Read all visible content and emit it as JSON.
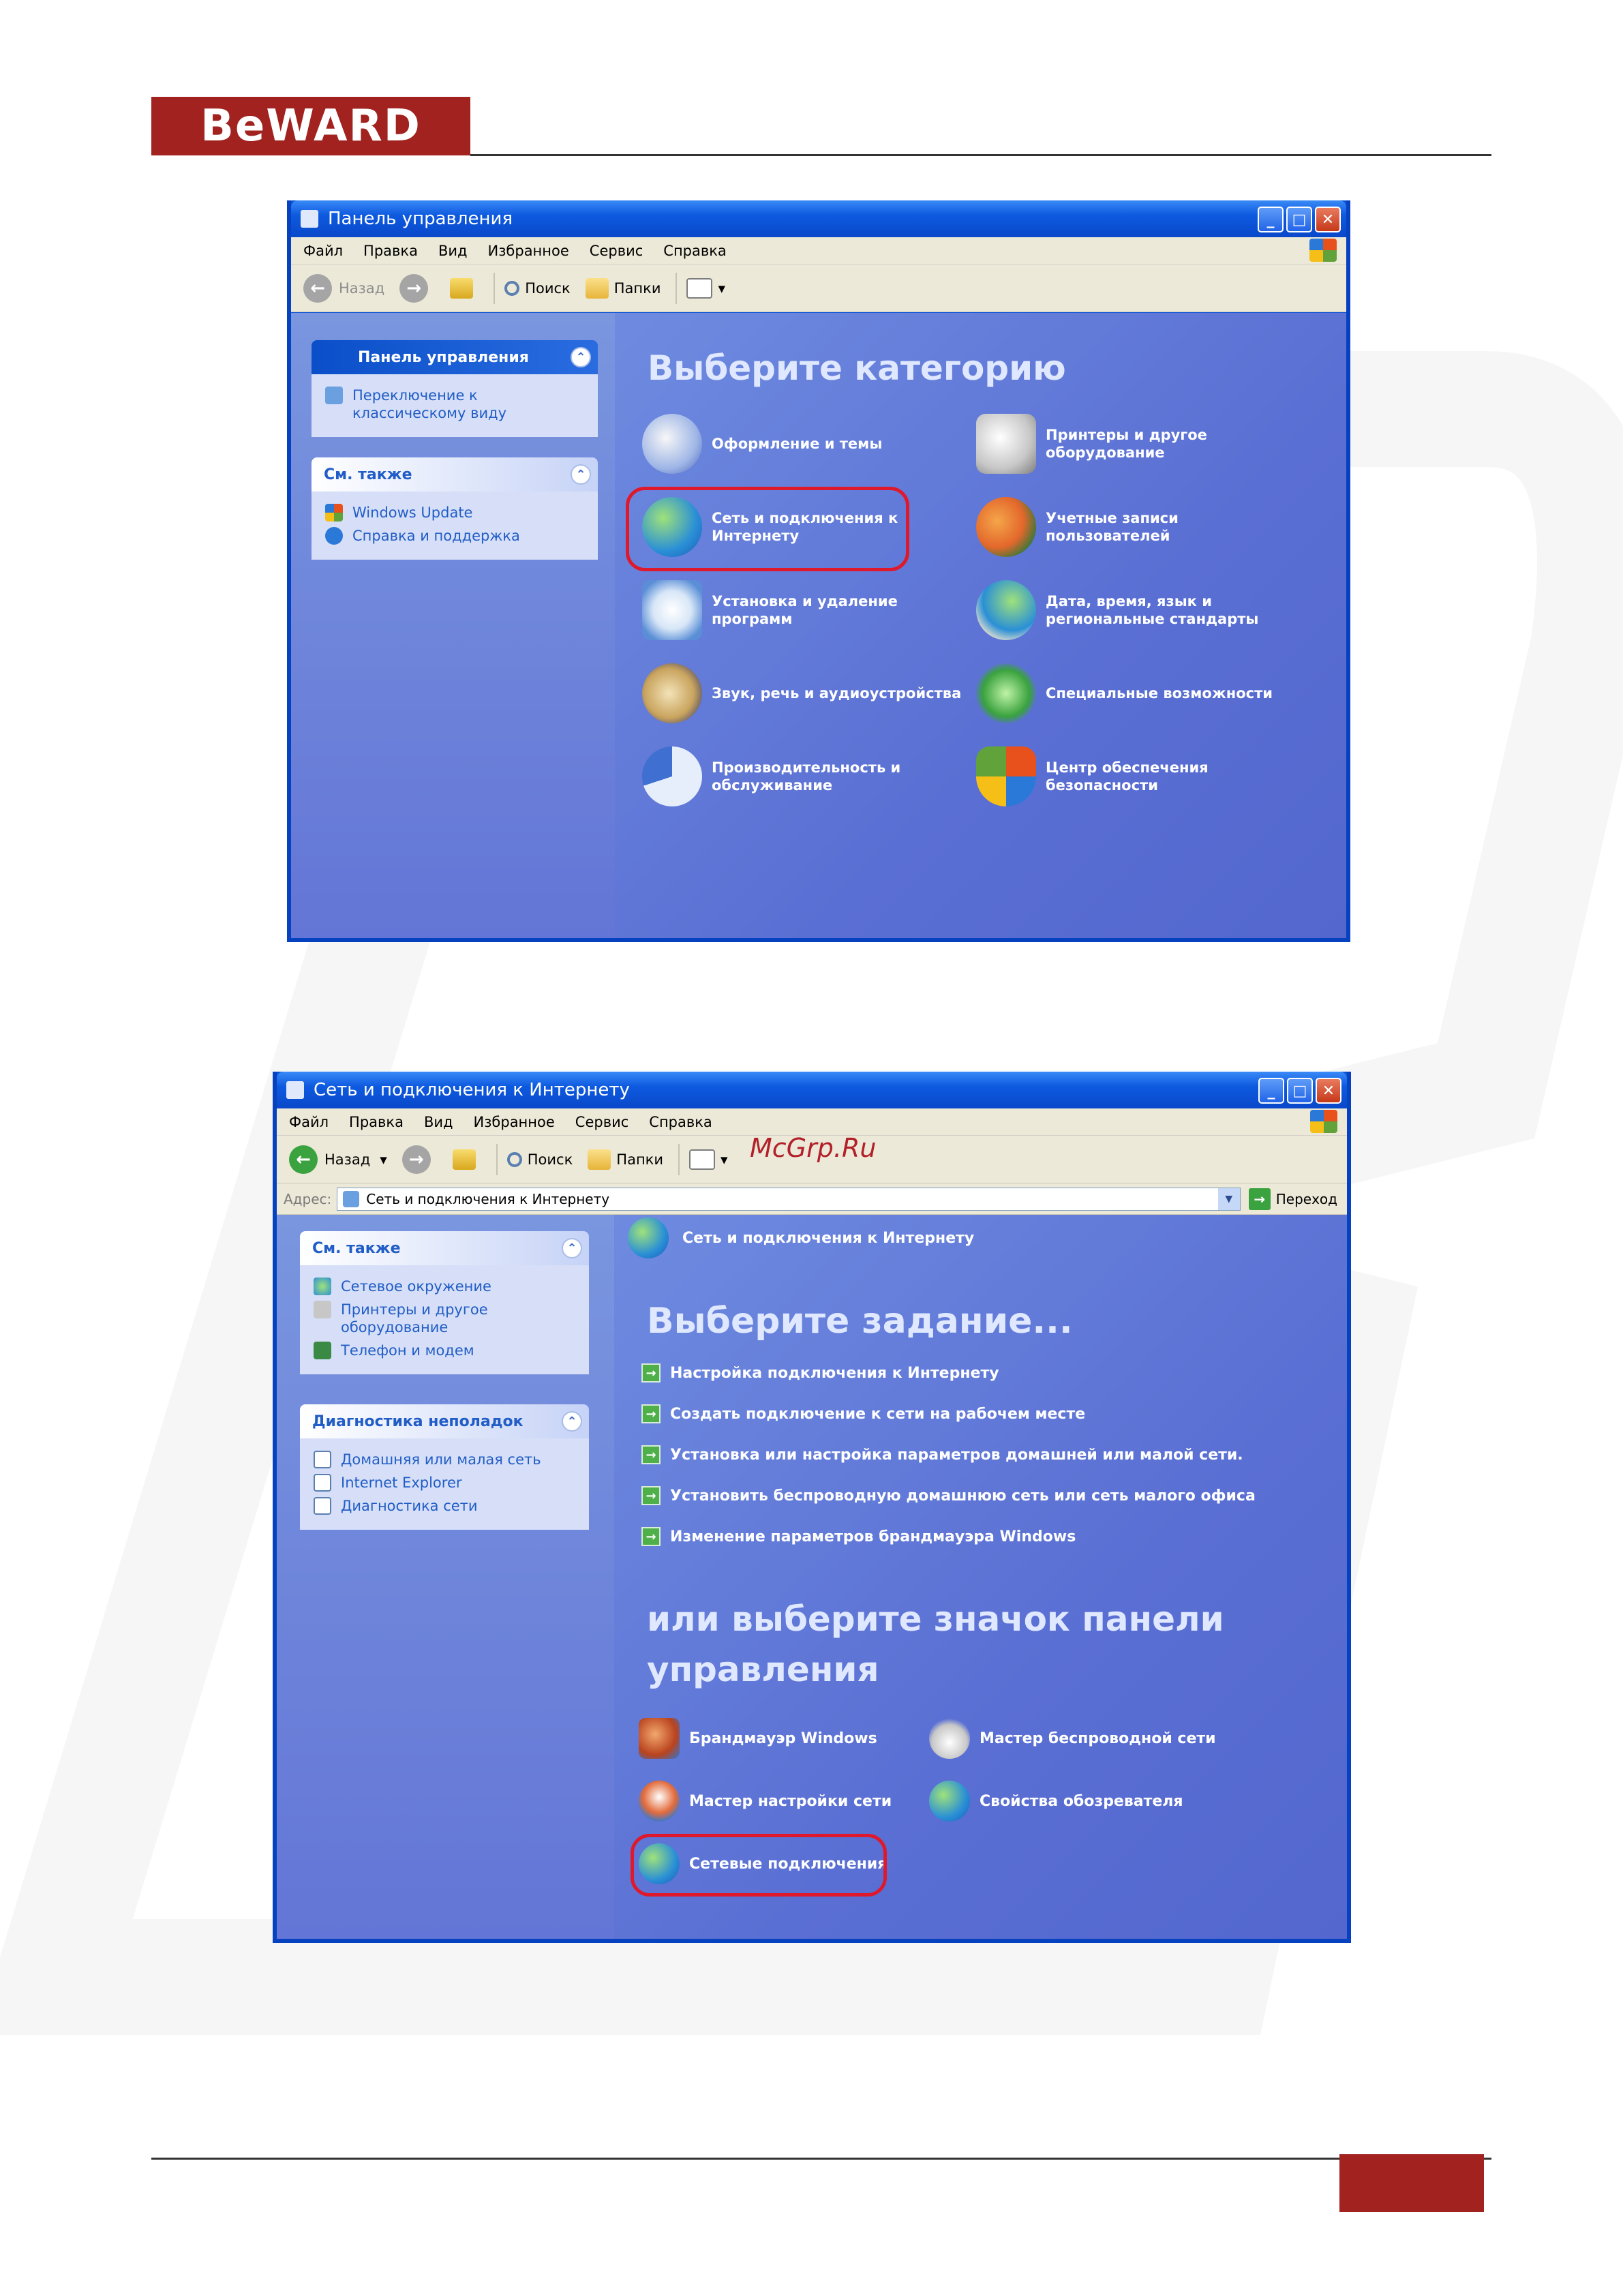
{
  "page": {
    "logo_text": "BeWARD",
    "watermark": "McGrp.Ru"
  },
  "win1": {
    "title": "Панель управления",
    "menu": [
      "Файл",
      "Правка",
      "Вид",
      "Избранное",
      "Сервис",
      "Справка"
    ],
    "toolbar": {
      "back": "Назад",
      "search": "Поиск",
      "folders": "Папки"
    },
    "pane1": {
      "title": "Панель управления",
      "link": "Переключение к классическому виду"
    },
    "pane2": {
      "title": "См. также",
      "links": [
        "Windows Update",
        "Справка и поддержка"
      ]
    },
    "heading": "Выберите категорию",
    "categories": [
      "Оформление и темы",
      "Принтеры и другое оборудование",
      "Сеть и подключения к Интернету",
      "Учетные записи пользователей",
      "Установка и удаление программ",
      "Дата, время, язык и региональные стандарты",
      "Звук, речь и аудиоустройства",
      "Специальные возможности",
      "Производительность и обслуживание",
      "Центр обеспечения безопасности"
    ]
  },
  "win2": {
    "title": "Сеть и подключения к Интернету",
    "menu": [
      "Файл",
      "Правка",
      "Вид",
      "Избранное",
      "Сервис",
      "Справка"
    ],
    "toolbar": {
      "back": "Назад",
      "search": "Поиск",
      "folders": "Папки"
    },
    "address": {
      "label": "Адрес:",
      "value": "Сеть и подключения к Интернету",
      "go": "Переход"
    },
    "pane1": {
      "title": "См. также",
      "links": [
        "Сетевое окружение",
        "Принтеры и другое оборудование",
        "Телефон и модем"
      ]
    },
    "pane2": {
      "title": "Диагностика неполадок",
      "links": [
        "Домашняя или малая сеть",
        "Internet Explorer",
        "Диагностика сети"
      ]
    },
    "pane_header": "Сеть и подключения к Интернету",
    "heading_tasks": "Выберите задание...",
    "tasks": [
      "Настройка подключения к Интернету",
      "Создать подключение к сети на рабочем месте",
      "Установка или настройка параметров домашней или малой сети.",
      "Установить беспроводную домашнюю сеть или сеть малого офиса",
      "Изменение параметров брандмауэра Windows"
    ],
    "heading_icons_line1": "или выберите значок панели",
    "heading_icons_line2": "управления",
    "icons": [
      "Брандмауэр Windows",
      "Мастер беспроводной сети",
      "Мастер настройки сети",
      "Свойства обозревателя",
      "Сетевые подключения"
    ]
  },
  "colors": {
    "brand": "#a1221f",
    "highlight": "#e0182b",
    "xp_blue": "#0b52d6"
  }
}
